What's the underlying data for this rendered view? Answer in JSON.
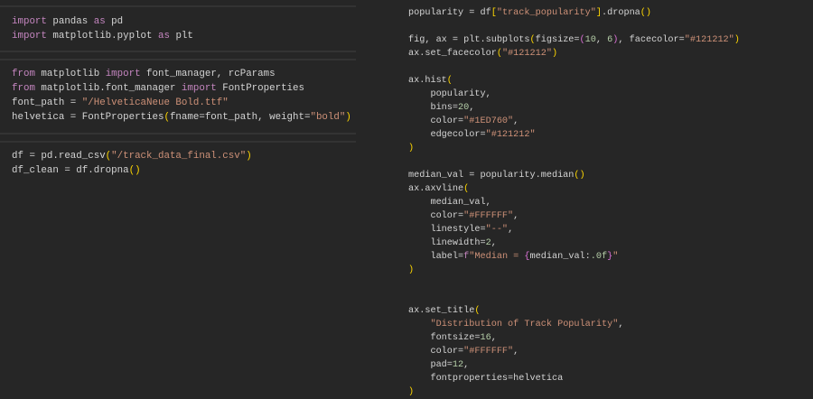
{
  "left_cells": [
    {
      "lines": [
        [
          [
            "import",
            "kw"
          ],
          [
            " pandas ",
            "pl"
          ],
          [
            "as",
            "kw"
          ],
          [
            " pd",
            "pl"
          ]
        ],
        [
          [
            "import",
            "kw"
          ],
          [
            " matplotlib.pyplot ",
            "pl"
          ],
          [
            "as",
            "kw"
          ],
          [
            " plt",
            "pl"
          ]
        ]
      ]
    },
    {
      "lines": [
        [
          [
            "from",
            "kw"
          ],
          [
            " matplotlib ",
            "pl"
          ],
          [
            "import",
            "kw"
          ],
          [
            " font_manager, rcParams",
            "pl"
          ]
        ],
        [
          [
            "from",
            "kw"
          ],
          [
            " matplotlib.font_manager ",
            "pl"
          ],
          [
            "import",
            "kw"
          ],
          [
            " FontProperties",
            "pl"
          ]
        ],
        [
          [
            "font_path = ",
            "pl"
          ],
          [
            "\"/HelveticaNeue Bold.ttf\"",
            "str"
          ]
        ],
        [
          [
            "helvetica = FontProperties",
            "pl"
          ],
          [
            "(",
            "br1"
          ],
          [
            "fname=font_path, weight=",
            "pl"
          ],
          [
            "\"bold\"",
            "str"
          ],
          [
            ")",
            "br1"
          ]
        ]
      ]
    },
    {
      "lines": [
        [
          [
            "df = pd.read_csv",
            "pl"
          ],
          [
            "(",
            "br1"
          ],
          [
            "\"/track_data_final.csv\"",
            "str"
          ],
          [
            ")",
            "br1"
          ]
        ],
        [
          [
            "df_clean = df.dropna",
            "pl"
          ],
          [
            "()",
            "br1"
          ]
        ]
      ]
    }
  ],
  "right_lines": [
    [
      [
        "popularity = df",
        "pl"
      ],
      [
        "[",
        "br1"
      ],
      [
        "\"track_popularity\"",
        "str"
      ],
      [
        "]",
        "br1"
      ],
      [
        ".dropna",
        "pl"
      ],
      [
        "()",
        "br1"
      ]
    ],
    [],
    [
      [
        "fig, ax = plt.subplots",
        "pl"
      ],
      [
        "(",
        "br1"
      ],
      [
        "figsize=",
        "pl"
      ],
      [
        "(",
        "br2"
      ],
      [
        "10",
        "num"
      ],
      [
        ", ",
        "pl"
      ],
      [
        "6",
        "num"
      ],
      [
        ")",
        "br2"
      ],
      [
        ", facecolor=",
        "pl"
      ],
      [
        "\"#121212\"",
        "str"
      ],
      [
        ")",
        "br1"
      ]
    ],
    [
      [
        "ax.set_facecolor",
        "pl"
      ],
      [
        "(",
        "br1"
      ],
      [
        "\"#121212\"",
        "str"
      ],
      [
        ")",
        "br1"
      ]
    ],
    [],
    [
      [
        "ax.hist",
        "pl"
      ],
      [
        "(",
        "br1"
      ]
    ],
    [
      [
        "    popularity,",
        "pl"
      ]
    ],
    [
      [
        "    bins=",
        "pl"
      ],
      [
        "20",
        "num"
      ],
      [
        ",",
        "pl"
      ]
    ],
    [
      [
        "    color=",
        "pl"
      ],
      [
        "\"#1ED760\"",
        "str"
      ],
      [
        ",",
        "pl"
      ]
    ],
    [
      [
        "    edgecolor=",
        "pl"
      ],
      [
        "\"#121212\"",
        "str"
      ]
    ],
    [
      [
        ")",
        "br1"
      ]
    ],
    [],
    [
      [
        "median_val = popularity.median",
        "pl"
      ],
      [
        "()",
        "br1"
      ]
    ],
    [
      [
        "ax.axvline",
        "pl"
      ],
      [
        "(",
        "br1"
      ]
    ],
    [
      [
        "    median_val,",
        "pl"
      ]
    ],
    [
      [
        "    color=",
        "pl"
      ],
      [
        "\"#FFFFFF\"",
        "str"
      ],
      [
        ",",
        "pl"
      ]
    ],
    [
      [
        "    linestyle=",
        "pl"
      ],
      [
        "\"--\"",
        "str"
      ],
      [
        ",",
        "pl"
      ]
    ],
    [
      [
        "    linewidth=",
        "pl"
      ],
      [
        "2",
        "num"
      ],
      [
        ",",
        "pl"
      ]
    ],
    [
      [
        "    label=",
        "pl"
      ],
      [
        "f",
        "kw"
      ],
      [
        "\"Median = ",
        "str"
      ],
      [
        "{",
        "br2"
      ],
      [
        "median_val:",
        "pl"
      ],
      [
        ".0f",
        "num"
      ],
      [
        "}",
        "br2"
      ],
      [
        "\"",
        "str"
      ]
    ],
    [
      [
        ")",
        "br1"
      ]
    ],
    [],
    [],
    [
      [
        "ax.set_title",
        "pl"
      ],
      [
        "(",
        "br1"
      ]
    ],
    [
      [
        "    ",
        "pl"
      ],
      [
        "\"Distribution of Track Popularity\"",
        "str"
      ],
      [
        ",",
        "pl"
      ]
    ],
    [
      [
        "    fontsize=",
        "pl"
      ],
      [
        "16",
        "num"
      ],
      [
        ",",
        "pl"
      ]
    ],
    [
      [
        "    color=",
        "pl"
      ],
      [
        "\"#FFFFFF\"",
        "str"
      ],
      [
        ",",
        "pl"
      ]
    ],
    [
      [
        "    pad=",
        "pl"
      ],
      [
        "12",
        "num"
      ],
      [
        ",",
        "pl"
      ]
    ],
    [
      [
        "    fontproperties=helvetica",
        "pl"
      ]
    ],
    [
      [
        ")",
        "br1"
      ]
    ]
  ]
}
